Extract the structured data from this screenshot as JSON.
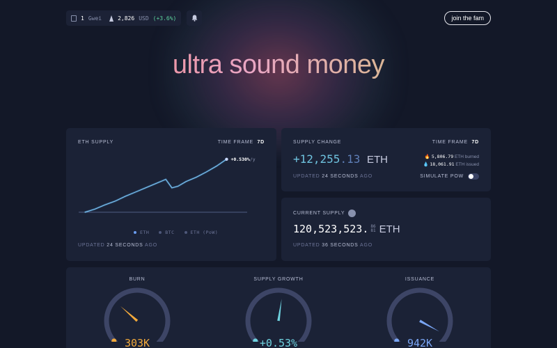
{
  "topbar": {
    "gas_value": "1",
    "gas_unit": "Gwei",
    "eth_price": "2,826",
    "eth_price_unit": "USD",
    "eth_price_change": "(+3.6%)",
    "join_label": "join the fam"
  },
  "hero": {
    "title": "ultra sound money"
  },
  "eth_supply": {
    "title": "ETH SUPPLY",
    "timeframe_label": "TIME FRAME",
    "timeframe_value": "7d",
    "end_label": "+0.530%",
    "end_label_suffix": "/y",
    "legend": [
      {
        "label": "ETH",
        "color": "#6a9cf0"
      },
      {
        "label": "BTC",
        "color": "#4e587a"
      },
      {
        "label": "ETH (PoW)",
        "color": "#4e587a"
      }
    ],
    "updated_prefix": "UPDATED",
    "updated_value": "24 SECONDS",
    "updated_suffix": "AGO",
    "chart_data": {
      "type": "line",
      "x": [
        0,
        0.5,
        1,
        1.5,
        2,
        2.5,
        3,
        3.5,
        4,
        4.3,
        4.6,
        5,
        5.5,
        6,
        6.5,
        7
      ],
      "series": [
        {
          "name": "ETH",
          "values": [
            0,
            0.6,
            1.4,
            2.1,
            3.0,
            3.8,
            4.6,
            5.4,
            6.2,
            4.6,
            4.9,
            5.8,
            6.6,
            7.6,
            8.7,
            10.0
          ]
        }
      ],
      "ylim": [
        -0.4,
        10.5
      ],
      "xlim": [
        -0.3,
        7.5
      ]
    }
  },
  "supply_change": {
    "title": "SUPPLY CHANGE",
    "timeframe_label": "TIME FRAME",
    "timeframe_value": "7d",
    "value_integer": "+12,255",
    "value_decimal": ".13",
    "unit": "ETH",
    "burned_value": "5,806.79",
    "burned_label": "ETH burned",
    "issued_value": "18,061.91",
    "issued_label": "ETH issued",
    "updated_prefix": "UPDATED",
    "updated_value": "24 SECONDS",
    "updated_suffix": "AGO",
    "simulate_label": "SIMULATE PoW"
  },
  "current_supply": {
    "title": "CURRENT SUPPLY",
    "value_integer": "120,523,523.",
    "decimals_top": "86",
    "decimals_bottom": "81",
    "unit": "ETH",
    "updated_prefix": "UPDATED",
    "updated_value": "36 SECONDS",
    "updated_suffix": "AGO"
  },
  "gauges": [
    {
      "label": "BURN",
      "value": "303K",
      "color": "#f2a93b",
      "level": 0.32
    },
    {
      "label": "SUPPLY GROWTH",
      "value": "+0.53%",
      "color": "#6fd3e0",
      "level": 0.53
    },
    {
      "label": "ISSUANCE",
      "value": "942K",
      "color": "#7aa6f5",
      "level": 0.94
    }
  ]
}
